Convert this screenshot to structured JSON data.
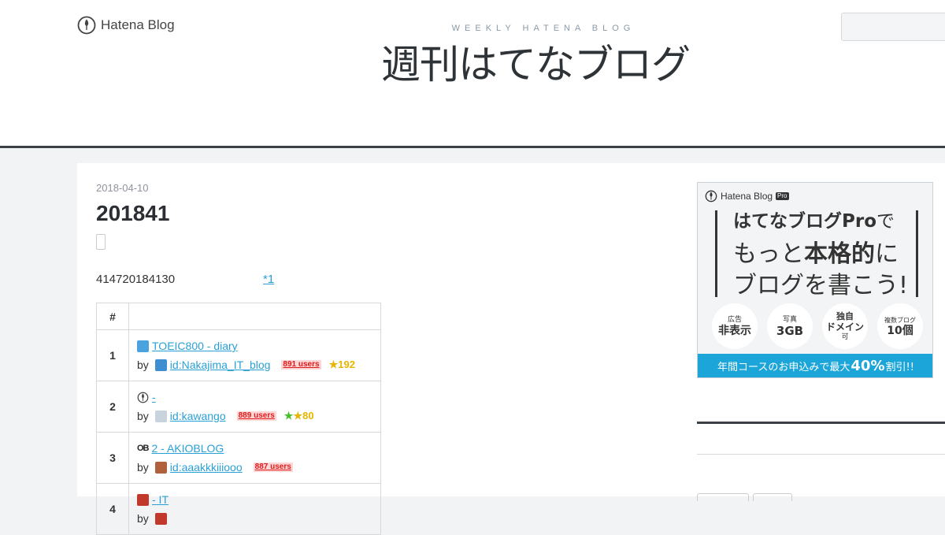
{
  "header": {
    "brand_logo_text": "Hatena Blog",
    "tagline": "WEEKLY HATENA BLOG",
    "blog_title": "週刊はてなブログ"
  },
  "entry": {
    "date": "2018-04-10",
    "title": "201841",
    "body_text": "414720184130",
    "footnote_link": "*1"
  },
  "ranking": {
    "headers": [
      "#",
      ""
    ],
    "rows": [
      {
        "rank": "1",
        "title": "TOEIC800 - diary",
        "by": "by",
        "user": "id:Nakajima_IT_blog",
        "users": "891 users",
        "stars": "★192",
        "icon": "blog-favicon",
        "user_icon": "user-avatar"
      },
      {
        "rank": "2",
        "title": "-",
        "by": "by",
        "user": "id:kawango",
        "users": "889 users",
        "stars": "★80",
        "icon": "hatena-favicon",
        "user_icon": "default-avatar"
      },
      {
        "rank": "3",
        "title": "2 - AKIOBLOG",
        "by": "by",
        "user": "id:aaakkkiiiooo",
        "users": "887 users",
        "stars": "",
        "icon": "akioblog-favicon",
        "user_icon": "user-avatar"
      },
      {
        "rank": "4",
        "title": "- IT",
        "by": "by",
        "user": "",
        "users": "",
        "stars": "",
        "icon": "blog-favicon",
        "user_icon": "user-avatar"
      }
    ]
  },
  "sidebar": {
    "pro_ad": {
      "logo_text": "Hatena Blog",
      "badge": "Pro",
      "line1_strong": "はてなブログPro",
      "line1_rest": "で",
      "line2_pre": "もっと",
      "line2_hl": "本格的",
      "line2_post": "に",
      "line3": "ブログを書こう!",
      "features": [
        {
          "top": "広告",
          "main": "非表示",
          "sub": ""
        },
        {
          "top": "写真",
          "main": "3GB",
          "sub": ""
        },
        {
          "top": "独自",
          "main": "ドメイン",
          "sub": "可"
        },
        {
          "top": "複数ブログ",
          "main": "10個",
          "sub": ""
        }
      ],
      "bar_pre": "年間コースのお申込みで最大",
      "bar_pct": "40%",
      "bar_post": "割引!!"
    }
  },
  "colors": {
    "link": "#2aa0d6",
    "header_rule": "#3b3f46",
    "users_badge": "#e01a1a",
    "star": "#e8b400",
    "pro_bar": "#1ba5d9"
  }
}
